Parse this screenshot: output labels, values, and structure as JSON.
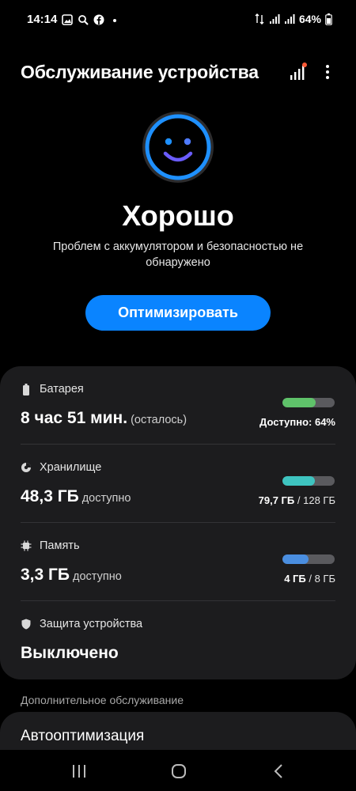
{
  "status_bar": {
    "time": "14:14",
    "left_icons": [
      "gallery-icon",
      "search-icon",
      "facebook-icon",
      "dot-icon"
    ],
    "right_icons": [
      "data-arrows-icon",
      "signal-icon",
      "signal-icon"
    ],
    "battery": "64%"
  },
  "header": {
    "title": "Обслуживание устройства",
    "icons": [
      "signal-bars-icon",
      "more-vert-icon"
    ],
    "notification_color": "#ff5a36"
  },
  "hero": {
    "face_icon": "smiley-face-icon",
    "status": "Хорошо",
    "description": "Проблем с аккумулятором и безопасностью не обнаружено",
    "button": "Оптимизировать"
  },
  "items": {
    "battery": {
      "icon": "battery-icon",
      "label": "Батарея",
      "value": "8 час 51 мин.",
      "suffix": "(осталось)",
      "bar_fraction": 0.64,
      "bar_color": "#5fc26a",
      "right_text": "Доступно: 64%"
    },
    "storage": {
      "icon": "storage-pie-icon",
      "label": "Хранилище",
      "value": "48,3 ГБ",
      "suffix": "доступно",
      "bar_fraction": 0.62,
      "bar_color": "#3ec4c0",
      "right_used": "79,7 ГБ",
      "right_total": " / 128 ГБ"
    },
    "memory": {
      "icon": "memory-chip-icon",
      "label": "Память",
      "value": "3,3 ГБ",
      "suffix": "доступно",
      "bar_fraction": 0.5,
      "bar_color": "#4a8ee0",
      "right_used": "4 ГБ",
      "right_total": " / 8 ГБ"
    },
    "security": {
      "icon": "shield-icon",
      "label": "Защита устройства",
      "value": "Выключено"
    }
  },
  "additional": {
    "header": "Дополнительное обслуживание",
    "auto_optimization": "Автооптимизация"
  },
  "nav_bar": {
    "icons": [
      "recent-apps-icon",
      "home-icon",
      "back-icon"
    ]
  },
  "colors": {
    "accent": "#0a84ff",
    "face_ring": "#1e90ff",
    "face_inner": "#5b6cff",
    "card_bg": "#1c1c1e"
  }
}
